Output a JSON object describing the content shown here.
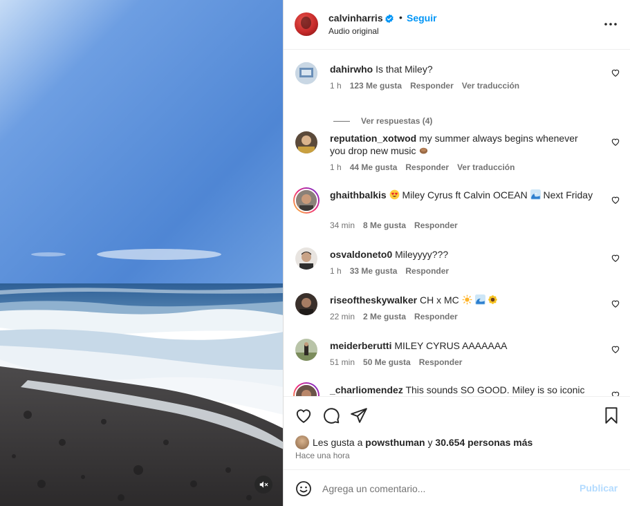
{
  "post": {
    "username": "calvinharris",
    "verified_icon": "verified-badge-icon",
    "dot": "•",
    "follow_label": "Seguir",
    "audio_label": "Audio original",
    "more_icon": "more-options-icon",
    "media_mute_icon": "muted-audio-icon"
  },
  "comments": [
    {
      "user": "dahirwho",
      "text": "Is that Miley?",
      "time": "1 h",
      "likes": "123 Me gusta",
      "reply": "Responder",
      "translate": "Ver traducción",
      "replies_label": "Ver respuestas (4)"
    },
    {
      "user": "reputation_xotwod",
      "text": "my summer always begins whenever you drop new music",
      "time": "1 h",
      "likes": "44 Me gusta",
      "reply": "Responder",
      "translate": "Ver traducción"
    },
    {
      "user": "ghaithbalkis",
      "text": "Miley Cyrus ft Calvin OCEAN",
      "text2": "Next Friday",
      "time": "34 min",
      "likes": "8 Me gusta",
      "reply": "Responder"
    },
    {
      "user": "osvaldoneto0",
      "text": "Mileyyyy???",
      "time": "1 h",
      "likes": "33 Me gusta",
      "reply": "Responder"
    },
    {
      "user": "riseoftheskywalker",
      "text": "CH x MC",
      "time": "22 min",
      "likes": "2 Me gusta",
      "reply": "Responder"
    },
    {
      "user": "meiderberutti",
      "text": "MILEY CYRUS AAAAAAA",
      "time": "51 min",
      "likes": "50 Me gusta",
      "reply": "Responder"
    },
    {
      "user": "_charliomendez",
      "text": "This sounds SO GOOD. Miley is so iconic"
    }
  ],
  "footer": {
    "likes_prefix": "Les gusta a",
    "likes_user": "powsthuman",
    "likes_joiner": "y",
    "likes_count": "30.654 personas más",
    "posted_when": "Hace una hora",
    "comment_placeholder": "Agrega un comentario...",
    "publish_label": "Publicar"
  },
  "colors": {
    "accent": "#0095f6",
    "muted_text": "#737373",
    "publish_disabled": "#b3dbff"
  }
}
